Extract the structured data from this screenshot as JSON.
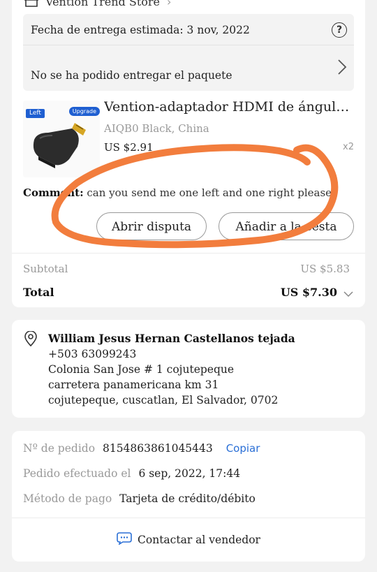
{
  "store": {
    "name": "Vention Trend Store"
  },
  "delivery": {
    "estimated": "Fecha de entrega estimada: 3 nov, 2022",
    "status": "No se ha podido entregar el paquete"
  },
  "product": {
    "badge_left": "Left",
    "badge_upgrade": "Upgrade",
    "title": "Vention-adaptador HDMI de ángulo r...",
    "variant": "AIQB0 Black, China",
    "price": "US $2.91",
    "quantity": "x2"
  },
  "comment": {
    "label": "Comment:",
    "text": "can you send me one left and one right please"
  },
  "buttons": {
    "dispute": "Abrir disputa",
    "add_to_cart": "Añadir a la cesta"
  },
  "totals": {
    "subtotal_label": "Subtotal",
    "subtotal_value": "US $5.83",
    "total_label": "Total",
    "total_value": "US $7.30"
  },
  "address": {
    "name": "William Jesus Hernan Castellanos tejada",
    "phone": "+503 63099243",
    "line1": "Colonia San Jose # 1 cojutepeque",
    "line2": "carretera panamericana km 31",
    "line3": "cojutepeque, cuscatlan, El Salvador, 0702"
  },
  "order_info": {
    "order_no_label": "Nº de pedido",
    "order_no_value": "8154863861045443",
    "copy_label": "Copiar",
    "placed_label": "Pedido efectuado el",
    "placed_value": "6 sep, 2022, 17:44",
    "payment_label": "Método de pago",
    "payment_value": "Tarjeta de crédito/débito",
    "contact_label": "Contactar al vendedor"
  },
  "colors": {
    "annotation": "#f27d3d",
    "link": "#2a6fd6",
    "badge": "#1f5fd1"
  },
  "icons": [
    "store-icon",
    "help-icon",
    "chevron-right-icon",
    "chevron-down-icon",
    "location-pin-icon",
    "chat-icon"
  ]
}
